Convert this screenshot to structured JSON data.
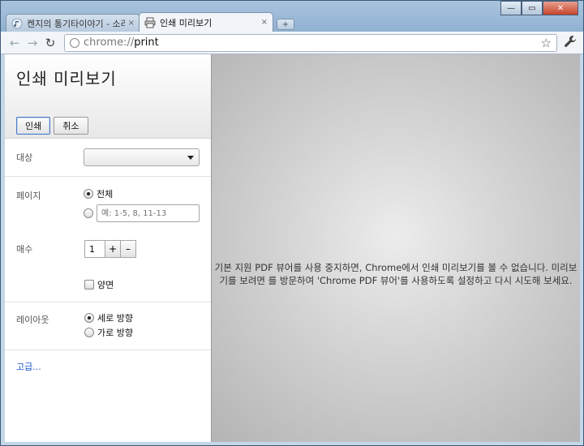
{
  "window": {
    "minimize_glyph": "—",
    "restore_glyph": "▭",
    "close_glyph": "✕"
  },
  "tabs": [
    {
      "title": "켄지의 통기타이야기 - 소리",
      "icon": "music-note-icon",
      "close": "×"
    },
    {
      "title": "인쇄 미리보기",
      "icon": "printer-icon",
      "close": "×"
    }
  ],
  "newtab_label": "+",
  "toolbar": {
    "back": "←",
    "forward": "→",
    "reload": "↻",
    "url_scheme": "chrome://",
    "url_host": "print",
    "star": "☆",
    "wrench": "🔧"
  },
  "sidebar": {
    "title": "인쇄 미리보기",
    "print_label": "인쇄",
    "cancel_label": "취소",
    "destination_label": "대상",
    "pages_label": "페이지",
    "pages_all_label": "전체",
    "pages_placeholder": "예: 1-5, 8, 11-13",
    "copies_label": "매수",
    "copies_value": "1",
    "plus": "+",
    "minus": "–",
    "duplex_label": "양면",
    "layout_label": "레이아웃",
    "portrait_label": "세로 방향",
    "landscape_label": "가로 방향",
    "advanced_link": "고급..."
  },
  "preview": {
    "message": "기본 지원 PDF 뷰어를 사용 중지하면, Chrome에서 인쇄 미리보기를 볼 수 없습니다. 미리보기를 보려면 를 방문하여 'Chrome PDF 뷰어'를 사용하도록 설정하고 다시 시도해 보세요."
  },
  "colors": {
    "accent": "#4f7ac7",
    "link": "#1a56c9"
  }
}
